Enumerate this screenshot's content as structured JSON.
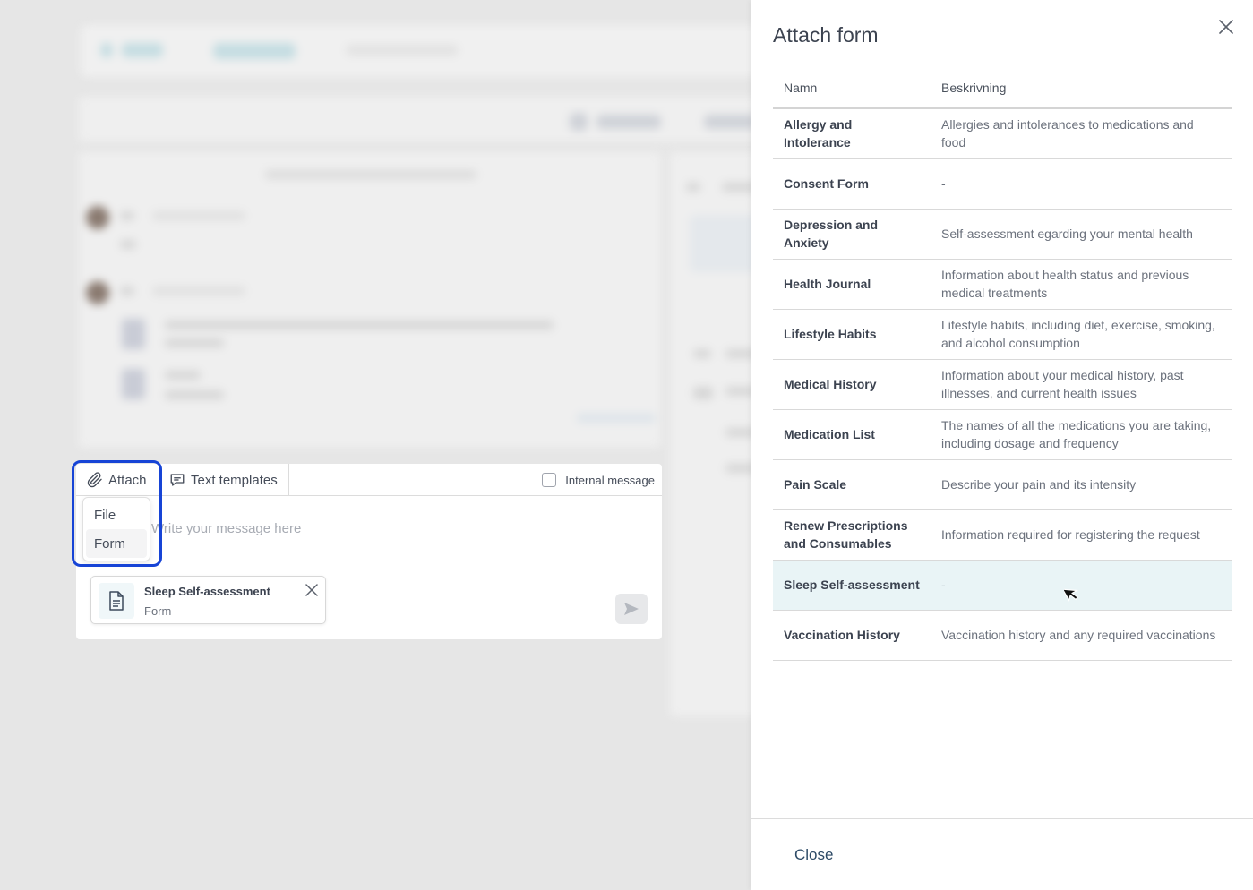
{
  "composer": {
    "attach_label": "Attach",
    "templates_label": "Text templates",
    "internal_label": "Internal message",
    "internal_checked": false,
    "placeholder": "Write your message here",
    "attach_menu": [
      {
        "label": "File"
      },
      {
        "label": "Form",
        "hovered": true
      }
    ],
    "attachment": {
      "title": "Sleep Self-assessment",
      "type": "Form",
      "icon": "document-icon"
    },
    "send_icon": "send-icon"
  },
  "drawer": {
    "title": "Attach form",
    "close_icon": "close-icon",
    "columns": [
      "Namn",
      "Beskrivning"
    ],
    "rows": [
      {
        "name": "Allergy and Intolerance",
        "description": "Allergies and intolerances to medications and food"
      },
      {
        "name": "Consent Form",
        "description": "-"
      },
      {
        "name": "Depression and Anxiety",
        "description": "Self-assessment egarding your mental health"
      },
      {
        "name": "Health Journal",
        "description": "Information about health status and previous medical treatments"
      },
      {
        "name": "Lifestyle Habits",
        "description": "Lifestyle habits, including diet, exercise, smoking, and alcohol consumption"
      },
      {
        "name": "Medical History",
        "description": "Information about your medical history, past illnesses, and current health issues"
      },
      {
        "name": "Medication List",
        "description": "The names of all the medications you are taking, including dosage and frequency"
      },
      {
        "name": "Pain Scale",
        "description": "Describe your pain and its intensity"
      },
      {
        "name": "Renew Prescriptions and Consumables",
        "description": "Information required for registering the request"
      },
      {
        "name": "Sleep Self-assessment",
        "description": "-",
        "selected": true
      },
      {
        "name": "Vaccination History",
        "description": "Vaccination history and any required vaccinations"
      }
    ],
    "close_label": "Close"
  },
  "colors": {
    "highlight": "#1744d6",
    "selected_row": "#e9f4f6",
    "close_button": "#2d4a66"
  }
}
